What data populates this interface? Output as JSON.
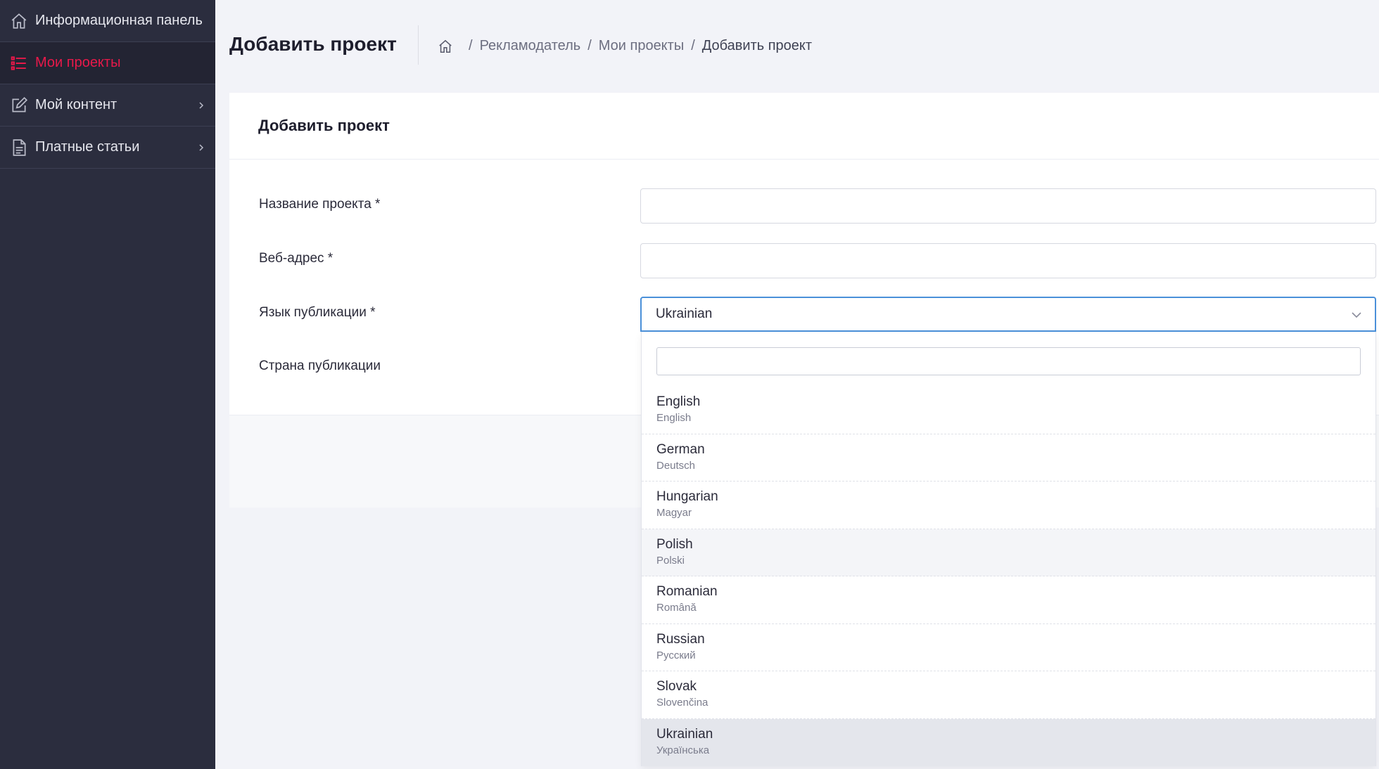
{
  "sidebar": {
    "items": [
      {
        "label": "Информационная панель",
        "icon": "home-icon"
      },
      {
        "label": "Мои проекты",
        "icon": "list-icon",
        "active": true
      },
      {
        "label": "Мой контент",
        "icon": "edit-icon",
        "has_submenu": true
      },
      {
        "label": "Платные статьи",
        "icon": "document-icon",
        "has_submenu": true
      }
    ]
  },
  "header": {
    "title": "Добавить проект",
    "breadcrumb": [
      "Рекламодатель",
      "Мои проекты",
      "Добавить проект"
    ]
  },
  "form": {
    "card_title": "Добавить проект",
    "fields": {
      "project_name_label": "Название проекта *",
      "project_name_value": "",
      "web_address_label": "Веб-адрес *",
      "web_address_value": "",
      "language_label": "Язык публикации *",
      "language_value": "Ukrainian",
      "country_label": "Страна публикации"
    }
  },
  "language_dropdown": {
    "search_value": "",
    "options": [
      {
        "name": "English",
        "native": "English"
      },
      {
        "name": "German",
        "native": "Deutsch"
      },
      {
        "name": "Hungarian",
        "native": "Magyar"
      },
      {
        "name": "Polish",
        "native": "Polski"
      },
      {
        "name": "Romanian",
        "native": "Română"
      },
      {
        "name": "Russian",
        "native": "Русский"
      },
      {
        "name": "Slovak",
        "native": "Slovenčina"
      },
      {
        "name": "Ukrainian",
        "native": "Українська"
      }
    ],
    "hovered": "Polish",
    "selected": "Ukrainian"
  },
  "colors": {
    "sidebar_bg": "#2b2d3e",
    "active_accent": "#e8194a",
    "focus_border": "#4a90d9"
  }
}
